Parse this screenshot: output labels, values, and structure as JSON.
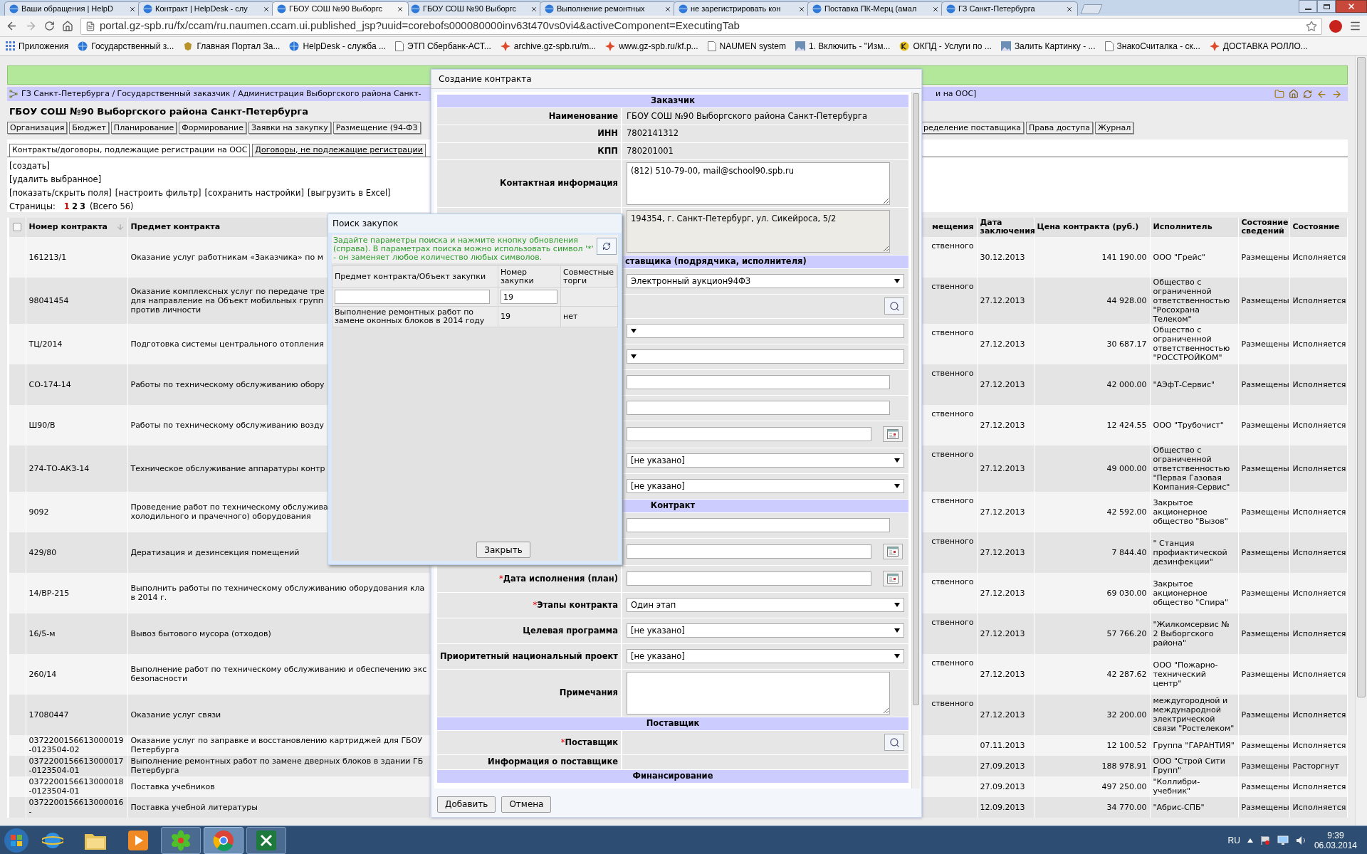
{
  "browser": {
    "tabs": [
      {
        "title": "Ваши обращения | HelpD",
        "selected": false
      },
      {
        "title": "Контракт | HelpDesk - слу",
        "selected": false
      },
      {
        "title": "ГБОУ СОШ №90 Выборгс",
        "selected": true
      },
      {
        "title": "ГБОУ СОШ №90 Выборгс",
        "selected": false
      },
      {
        "title": "Выполнение ремонтных",
        "selected": false
      },
      {
        "title": "не зарегистрировать кон",
        "selected": false
      },
      {
        "title": "Поставка ПК-Мерц (амал",
        "selected": false
      },
      {
        "title": "ГЗ Санкт-Петербурга",
        "selected": false
      }
    ],
    "address": "portal.gz-spb.ru/fx/ccam/ru.naumen.ccam.ui.published_jsp?uuid=corebofs000080000inv63t470vs0vi4&activeComponent=ExecutingTab",
    "bookmarks": [
      {
        "label": "Приложения",
        "kind": "apps"
      },
      {
        "label": "Государственный з...",
        "kind": "globe"
      },
      {
        "label": "Главная Портал За...",
        "kind": "emblem"
      },
      {
        "label": "HelpDesk - служба ...",
        "kind": "globe"
      },
      {
        "label": "ЭТП Сбербанк-АСТ...",
        "kind": "page"
      },
      {
        "label": "archive.gz-spb.ru/m...",
        "kind": "red"
      },
      {
        "label": "www.gz-spb.ru/kf.p...",
        "kind": "red"
      },
      {
        "label": "NAUMEN system",
        "kind": "page"
      },
      {
        "label": "1. Включить - \"Изм...",
        "kind": "photo"
      },
      {
        "label": "ОКПД - Услуги по ...",
        "kind": "yellow"
      },
      {
        "label": "Залить Картинку - ...",
        "kind": "photo"
      },
      {
        "label": "ЗнакоСчиталка - ск...",
        "kind": "page"
      },
      {
        "label": "ДОСТАВКА РОЛЛО...",
        "kind": "red"
      }
    ]
  },
  "app": {
    "breadcrumb": "ГЗ Санкт-Петербурга / Государственный заказчик / Администрация Выборгского района Санкт-",
    "breadcrumb_tail": "и на ООС]",
    "title": "ГБОУ СОШ №90 Выборгского района Санкт-Петербурга",
    "nav_left": [
      "Организация",
      "Бюджет",
      "Планирование",
      "Формирование",
      "Заявки на закупку",
      "Размещение (94-ФЗ"
    ],
    "nav_right": [
      "ределение поставщика",
      "Права доступа",
      "Журнал"
    ],
    "subtabs": [
      {
        "label": "Контракты/договоры, подлежащие регистрации на ООС",
        "selected": true
      },
      {
        "label": "Договоры, не подлежащие регистрации",
        "selected": false
      }
    ],
    "actions": [
      [
        "[создать]"
      ],
      [
        "[удалить выбранное]"
      ],
      [
        "[показать/скрыть поля]",
        "[настроить фильтр]",
        "[сохранить настройки]",
        "[выгрузить в Excel]"
      ]
    ],
    "pages_label": "Страницы:",
    "pages": [
      {
        "label": "1",
        "selected": true
      },
      {
        "label": "2",
        "selected": false
      },
      {
        "label": "3",
        "selected": false
      }
    ],
    "pages_total": "(Всего 56)",
    "table": {
      "select_all_checked": false,
      "columns": [
        "Номер контракта",
        "Предмет контракта",
        "мещения",
        "Дата заключения",
        "Цена контракта (руб.)",
        "Исполнитель",
        "Состояние сведений",
        "Состояние"
      ],
      "rows": [
        {
          "number": "161213/1",
          "subject": "Оказание услуг работникам «Заказчика» по м",
          "column_3": "ственного",
          "date": "30.12.2013",
          "price": "141 190.00",
          "executor": "ООО \"Грейс\"",
          "info": "Размещены",
          "state": "Исполняется"
        },
        {
          "number": "98041454",
          "subject": "Оказание комплексных услуг по передаче тре\nдля направление на Объект мобильных групп\nпротив личности",
          "column_3": "ственного",
          "date": "27.12.2013",
          "price": "44 928.00",
          "executor": "Общество с ограниченной ответственностью \"Росохрана Телеком\"",
          "info": "Размещены",
          "state": "Исполняется"
        },
        {
          "number": "ТЦ/2014",
          "subject": "Подготовка системы центрального отопления",
          "column_3": "ственного",
          "date": "27.12.2013",
          "price": "30 687.17",
          "executor": "Общество с ограниченной ответственностью \"РОССТРОЙКОМ\"",
          "info": "Размещены",
          "state": "Исполняется"
        },
        {
          "number": "СО-174-14",
          "subject": "Работы по техническому обслуживанию обору",
          "column_3": "ственного",
          "date": "27.12.2013",
          "price": "42 000.00",
          "executor": "\"АЭфТ-Сервис\"",
          "info": "Размещены",
          "state": "Исполняется"
        },
        {
          "number": "Ш90/В",
          "subject": "Работы по техническому обслуживанию возду",
          "column_3": "ственного",
          "date": "27.12.2013",
          "price": "12 424.55",
          "executor": "ООО \"Трубочист\"",
          "info": "Размещены",
          "state": "Исполняется"
        },
        {
          "number": "274-ТО-АКЗ-14",
          "subject": "Техническое обслуживание аппаратуры контр",
          "column_3": "ственного",
          "date": "27.12.2013",
          "price": "49 000.00",
          "executor": "Общество с ограниченной ответственностью \"Первая Газовая Компания-Сервис\"",
          "info": "Размещены",
          "state": "Исполняется"
        },
        {
          "number": "9092",
          "subject": "Проведение работ по техническому обслужива\nхолодильного и прачечного) оборудования",
          "column_3": "ственного",
          "date": "27.12.2013",
          "price": "42 592.00",
          "executor": "Закрытое акционерное общество \"Вызов\"",
          "info": "Размещены",
          "state": "Исполняется"
        },
        {
          "number": "429/80",
          "subject": "Дератизация и дезинсекция помещений",
          "column_3": "ственного",
          "date": "27.12.2013",
          "price": "7 844.40",
          "executor": "\" Станция профиактической дезинфекции\"",
          "info": "Размещены",
          "state": "Исполняется"
        },
        {
          "number": "14/ВР-215",
          "subject": "Выполнить работы по техническому обслуживанию оборудования кла\nв 2014 г.",
          "column_3": "ственного",
          "date": "27.12.2013",
          "price": "69 030.00",
          "executor": "Закрытое акционерное общество \"Спира\"",
          "info": "Размещены",
          "state": "Исполняется"
        },
        {
          "number": "16/5-м",
          "subject": "Вывоз бытового мусора (отходов)",
          "column_3": "ственного",
          "date": "27.12.2013",
          "price": "57 766.20",
          "executor": "\"Жилкомсервис № 2 Выборгского района\"",
          "info": "Размещены",
          "state": "Исполняется"
        },
        {
          "number": "260/14",
          "subject": "Выполнение работ по техническому обслуживанию и обеспечению экс\nбезопасности",
          "column_3": "ственного",
          "date": "27.12.2013",
          "price": "42 287.62",
          "executor": "ООО \"Пожарно-технический центр\"",
          "info": "Размещены",
          "state": "Исполняется"
        },
        {
          "number": "17080447",
          "subject": "Оказание услуг связи",
          "column_3": "ственного",
          "date": "27.12.2013",
          "price": "32 200.00",
          "executor": "междугородной и международной электрической связи \"Ростелеком\"",
          "info": "Размещены",
          "state": "Исполняется"
        },
        {
          "number": "0372200156613000019-0123504-02",
          "subject": "Оказание услуг по заправке и восстановлению картриджей для ГБОУ\nПетербурга",
          "date": "07.11.2013",
          "price": "12 100.52",
          "executor": "Группа \"ГАРАНТИЯ\"",
          "info": "Размещены",
          "state": "Исполняется"
        },
        {
          "number": "0372200156613000017-0123504-01",
          "subject": "Выполнение ремонтных работ по замене дверных блоков в здании ГБ\nПетербурга",
          "date": "27.09.2013",
          "price": "188 978.91",
          "executor": "ООО \"Строй Сити Групп\"",
          "info": "Размещены",
          "state": "Расторгнут"
        },
        {
          "number": "0372200156613000018-0123504-01",
          "subject": "Поставка учебников",
          "date": "27.09.2013",
          "price": "497 250.00",
          "executor": "\"Коллибри-учебник\"",
          "info": "Размещены",
          "state": "Исполняется"
        },
        {
          "number": "0372200156613000016-",
          "subject": "Поставка учебной литературы",
          "date": "12.09.2013",
          "price": "34 770.00",
          "executor": "\"Абрис-СПБ\"",
          "info": "Размещены",
          "state": "Исполняется"
        }
      ]
    }
  },
  "contract_dialog": {
    "title": "Создание контракта",
    "rows": [
      {
        "kind": "section",
        "title": "Заказчик",
        "cut": false
      },
      {
        "kind": "text",
        "label": "Наименование",
        "value": "ГБОУ СОШ №90 Выборгского района Санкт-Петербурга"
      },
      {
        "kind": "text",
        "label": "ИНН",
        "value": "7802141312"
      },
      {
        "kind": "text",
        "label": "КПП",
        "value": "780201001"
      },
      {
        "kind": "textarea",
        "label": "Контактная информация",
        "value": "(812) 510-79-00, mail@school90.spb.ru",
        "disabled": false
      },
      {
        "kind": "textarea",
        "value": "194354, г. Санкт-Петербург, ул. Сикейроса, 5/2",
        "disabled": true
      },
      {
        "kind": "section",
        "title": "ставщика (подрядчика, исполнителя)",
        "cut": true
      },
      {
        "kind": "select",
        "value": "Электронный аукцион94ФЗ"
      },
      {
        "kind": "search"
      },
      {
        "kind": "select"
      },
      {
        "kind": "select"
      },
      {
        "kind": "input"
      },
      {
        "kind": "input"
      },
      {
        "kind": "date"
      },
      {
        "kind": "select",
        "value": "[не указано]"
      },
      {
        "kind": "select",
        "value": "[не указано]"
      },
      {
        "kind": "section",
        "title": "Контракт",
        "cut": false
      },
      {
        "kind": "input"
      },
      {
        "kind": "date"
      },
      {
        "kind": "date",
        "label": "Дата исполнения (план)",
        "required_mark": "*"
      },
      {
        "kind": "select",
        "label": "Этапы контракта",
        "required_mark": "*",
        "value": "Один этап"
      },
      {
        "kind": "select",
        "label": "Целевая программа",
        "value": "[не указано]"
      },
      {
        "kind": "select",
        "label": "Приоритетный национальный проект",
        "value": "[не указано]"
      },
      {
        "kind": "textarea",
        "label": "Примечания",
        "disabled": false
      },
      {
        "kind": "section",
        "title": "Поставщик",
        "cut": false
      },
      {
        "kind": "search",
        "label": "Поставщик",
        "required_mark": "*"
      },
      {
        "kind": "text",
        "label": "Информация о поставщике"
      },
      {
        "kind": "section",
        "title": "Финансирование",
        "cut": false
      }
    ],
    "buttons": [
      "Добавить",
      "Отмена"
    ]
  },
  "search_dialog": {
    "title": "Поиск закупок",
    "hint": "Задайте параметры поиска и нажмите кнопку обновления (справа). В параметрах поиска можно использовать символ '*' - он заменяет любое количество любых символов.",
    "columns": [
      "Предмет контракта/Объект закупки",
      "Номер закупки",
      "Совместные торги"
    ],
    "number_filter": "19",
    "results": [
      {
        "subject": "Выполнение ремонтных работ по замене оконных блоков в 2014 году",
        "number": "19",
        "joint": "нет"
      }
    ],
    "close_button": "Закрыть"
  },
  "taskbar": {
    "language": "RU",
    "time": "9:39",
    "date": "06.03.2014"
  }
}
